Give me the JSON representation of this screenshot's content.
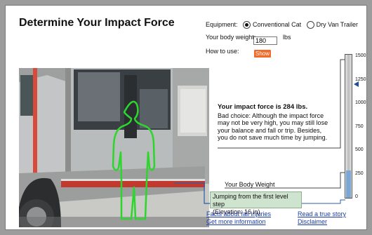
{
  "title": "Determine Your Impact Force",
  "equipment": {
    "label": "Equipment:",
    "option1": "Conventional Cat",
    "option2": "Dry Van Trailer",
    "selected": "Conventional Cat"
  },
  "body_weight": {
    "label": "Your body weight:",
    "value": "180",
    "unit": "lbs"
  },
  "how_to_use": {
    "label": "How to use:",
    "button": "Show"
  },
  "impact": {
    "heading": "Your impact force is 284 lbs.",
    "message": "Bad choice: Although the impact force may not be very high, you may still lose your balance and fall or trip. Besides, you do not save much time by jumping."
  },
  "body_weight_label": "Your Body Weight",
  "jump": {
    "line1": "Jumping from the first level step",
    "line2": "(Elevation: 16 in)"
  },
  "links": {
    "fall_injuries": "Facts about fall injuries",
    "more_info": "Get more information",
    "true_story": "Read a true story",
    "disclaimer": "Disclaimer"
  },
  "scale": {
    "ticks": [
      "1500",
      "1250",
      "1000",
      "750",
      "500",
      "250",
      "0"
    ],
    "min": 0,
    "max": 1500,
    "impact_value": 284,
    "marker_value": 1200
  },
  "colors": {
    "show_button": "#f26a2a",
    "jump_box": "#cfe4cf",
    "figure": "#2dd62d",
    "marker": "#1d4f9a",
    "link": "#1a3ca8"
  }
}
